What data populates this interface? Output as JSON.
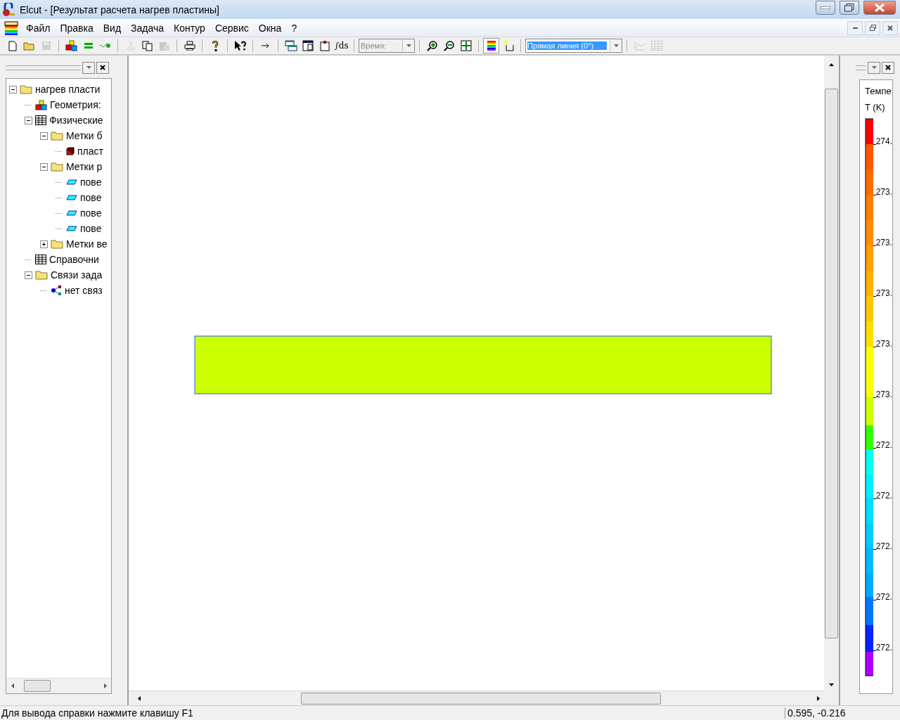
{
  "window": {
    "title": "Elcut - [Результат расчета нагрев пластины]"
  },
  "menu": [
    "Файл",
    "Правка",
    "Вид",
    "Задача",
    "Контур",
    "Сервис",
    "Окна",
    "?"
  ],
  "toolbar": [
    {
      "kind": "button",
      "disabled": false
    },
    {
      "kind": "button",
      "disabled": false
    },
    {
      "kind": "button",
      "disabled": true
    },
    {
      "kind": "separator"
    },
    {
      "kind": "button",
      "disabled": false
    },
    {
      "kind": "button",
      "disabled": false
    },
    {
      "kind": "button",
      "disabled": false
    },
    {
      "kind": "separator"
    },
    {
      "kind": "button",
      "disabled": true
    },
    {
      "kind": "button",
      "disabled": false
    },
    {
      "kind": "button",
      "disabled": true
    },
    {
      "kind": "separator"
    },
    {
      "kind": "button",
      "disabled": false
    },
    {
      "kind": "separator"
    },
    {
      "kind": "button",
      "disabled": false
    },
    {
      "kind": "separator"
    },
    {
      "kind": "button",
      "disabled": false
    },
    {
      "kind": "separator"
    },
    {
      "kind": "button",
      "disabled": false
    },
    {
      "kind": "separator"
    },
    {
      "kind": "button",
      "disabled": false
    },
    {
      "kind": "button",
      "disabled": false
    },
    {
      "kind": "button",
      "disabled": false
    },
    {
      "kind": "button",
      "disabled": false,
      "label": "∫ds"
    },
    {
      "kind": "separator"
    },
    {
      "kind": "combo",
      "value": "Время:",
      "disabled": true,
      "highlighted": false
    },
    {
      "kind": "separator"
    },
    {
      "kind": "button",
      "disabled": false
    },
    {
      "kind": "button",
      "disabled": false
    },
    {
      "kind": "button",
      "disabled": false
    },
    {
      "kind": "separator"
    },
    {
      "kind": "button",
      "disabled": false,
      "pressed": true
    },
    {
      "kind": "button",
      "disabled": false,
      "pressed": false
    },
    {
      "kind": "separator"
    },
    {
      "kind": "combo",
      "value": "Прямая линия (0°)",
      "disabled": false,
      "highlighted": true
    },
    {
      "kind": "separator"
    },
    {
      "kind": "button",
      "disabled": true
    },
    {
      "kind": "button",
      "disabled": true
    }
  ],
  "tree": [
    {
      "label": "нагрев пласти",
      "kind": "folder",
      "expanded": true,
      "children": [
        {
          "label": "Геометрия:",
          "kind": "geometry"
        },
        {
          "label": "Физические",
          "kind": "table",
          "expanded": true,
          "children": [
            {
              "label": "Метки б",
              "kind": "folder",
              "expanded": true,
              "children": [
                {
                  "label": "пласт",
                  "kind": "block"
                }
              ]
            },
            {
              "label": "Метки р",
              "kind": "folder",
              "expanded": true,
              "children": [
                {
                  "label": "пове",
                  "kind": "edge"
                },
                {
                  "label": "пове",
                  "kind": "edge"
                },
                {
                  "label": "пове",
                  "kind": "edge"
                },
                {
                  "label": "пове",
                  "kind": "edge"
                }
              ]
            },
            {
              "label": "Метки ве",
              "kind": "folder",
              "expanded": false
            }
          ]
        },
        {
          "label": "Справочни",
          "kind": "table"
        },
        {
          "label": "Связи зада",
          "kind": "folder",
          "expanded": true,
          "children": [
            {
              "label": "нет связ",
              "kind": "link"
            }
          ]
        }
      ]
    }
  ],
  "legend": {
    "title": "Темпе",
    "unit": "T (K)",
    "ticks": [
      "274.",
      "273.",
      "273.",
      "273.",
      "273.",
      "273.",
      "272.",
      "272.",
      "272.",
      "272.",
      "272."
    ]
  },
  "status_bar": {
    "message": "Для вывода справки нажмите клавишу F1",
    "coordinates": "0.595, -0.216"
  }
}
